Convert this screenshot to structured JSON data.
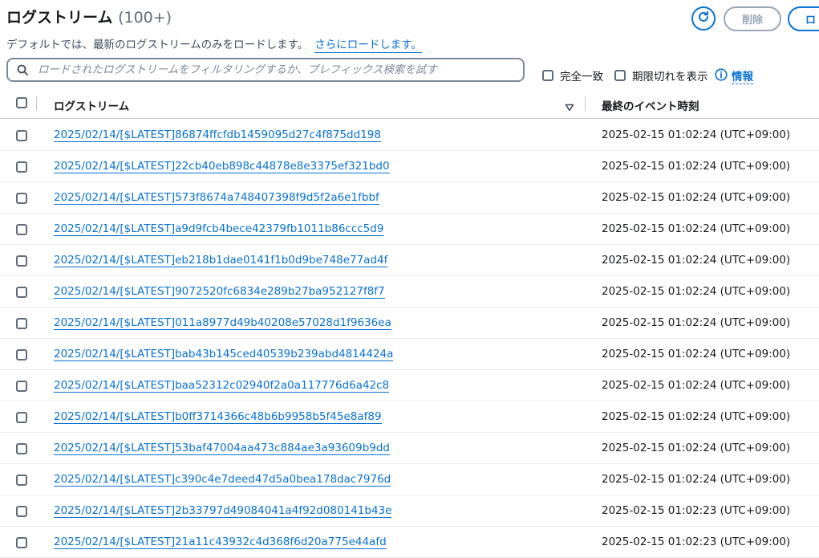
{
  "header": {
    "title": "ログストリーム",
    "count": "(100+)",
    "delete_label": "削除",
    "create_label": "ロ",
    "description": "デフォルトでは、最新のログストリームのみをロードします。",
    "more_link": "さらにロードします。"
  },
  "search": {
    "placeholder": "ロードされたログストリームをフィルタリングするか、プレフィックス検索を試す",
    "value": ""
  },
  "options": {
    "exact_match": "完全一致",
    "show_expired": "期限切れを表示",
    "info": "情報"
  },
  "table": {
    "col_stream": "ログストリーム",
    "col_last_event": "最終のイベント時刻",
    "rows": [
      {
        "name": "2025/02/14/[$LATEST]86874ffcfdb1459095d27c4f875dd198",
        "time": "2025-02-15 01:02:24 (UTC+09:00)"
      },
      {
        "name": "2025/02/14/[$LATEST]22cb40eb898c44878e8e3375ef321bd0",
        "time": "2025-02-15 01:02:24 (UTC+09:00)"
      },
      {
        "name": "2025/02/14/[$LATEST]573f8674a748407398f9d5f2a6e1fbbf",
        "time": "2025-02-15 01:02:24 (UTC+09:00)"
      },
      {
        "name": "2025/02/14/[$LATEST]a9d9fcb4bece42379fb1011b86ccc5d9",
        "time": "2025-02-15 01:02:24 (UTC+09:00)"
      },
      {
        "name": "2025/02/14/[$LATEST]eb218b1dae0141f1b0d9be748e77ad4f",
        "time": "2025-02-15 01:02:24 (UTC+09:00)"
      },
      {
        "name": "2025/02/14/[$LATEST]9072520fc6834e289b27ba952127f8f7",
        "time": "2025-02-15 01:02:24 (UTC+09:00)"
      },
      {
        "name": "2025/02/14/[$LATEST]011a8977d49b40208e57028d1f9636ea",
        "time": "2025-02-15 01:02:24 (UTC+09:00)"
      },
      {
        "name": "2025/02/14/[$LATEST]bab43b145ced40539b239abd4814424a",
        "time": "2025-02-15 01:02:24 (UTC+09:00)"
      },
      {
        "name": "2025/02/14/[$LATEST]baa52312c02940f2a0a117776d6a42c8",
        "time": "2025-02-15 01:02:24 (UTC+09:00)"
      },
      {
        "name": "2025/02/14/[$LATEST]b0ff3714366c48b6b9958b5f45e8af89",
        "time": "2025-02-15 01:02:24 (UTC+09:00)"
      },
      {
        "name": "2025/02/14/[$LATEST]53baf47004aa473c884ae3a93609b9dd",
        "time": "2025-02-15 01:02:24 (UTC+09:00)"
      },
      {
        "name": "2025/02/14/[$LATEST]c390c4e7deed47d5a0bea178dac7976d",
        "time": "2025-02-15 01:02:24 (UTC+09:00)"
      },
      {
        "name": "2025/02/14/[$LATEST]2b33797d49084041a4f92d080141b43e",
        "time": "2025-02-15 01:02:23 (UTC+09:00)"
      },
      {
        "name": "2025/02/14/[$LATEST]21a11c43932c4d368f6d20a775e44afd",
        "time": "2025-02-15 01:02:23 (UTC+09:00)"
      }
    ]
  },
  "colors": {
    "link": "#0972d3",
    "text": "#16191f",
    "disabled": "#9ba7b6"
  },
  "icons": {
    "refresh": "refresh-icon",
    "search": "search-icon",
    "info": "info-icon",
    "sort": "sort-desc-icon"
  }
}
